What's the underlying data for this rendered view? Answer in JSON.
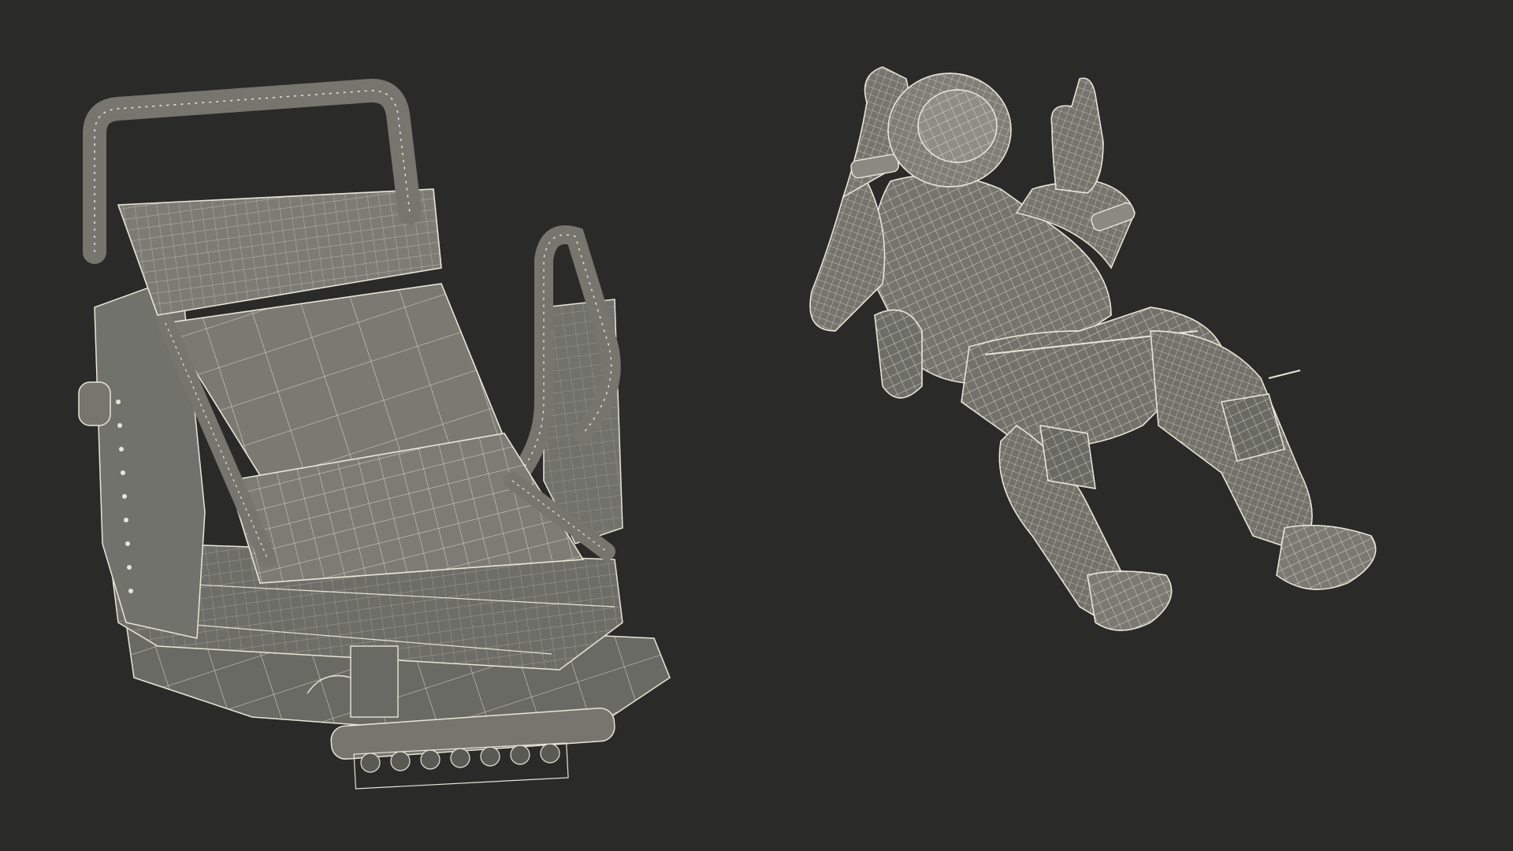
{
  "scene": {
    "background_color": "#2a2a28",
    "shading": "wireframe-on-clay",
    "mesh_fill_color": "#76766f",
    "mesh_shadow_color": "#4e4e49",
    "wire_color": "#e8e6d8",
    "objects": [
      {
        "name": "seat",
        "icon": "spacecraft-seat-icon"
      },
      {
        "name": "astronaut",
        "icon": "floating-astronaut-icon"
      }
    ]
  }
}
